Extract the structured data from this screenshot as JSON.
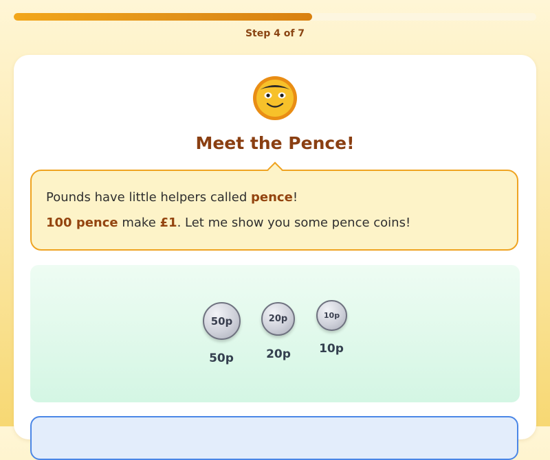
{
  "progress": {
    "step_text": "Step 4 of 7",
    "fraction": 0.571
  },
  "lesson": {
    "title": "Meet the Pence!",
    "bubble": {
      "line1": {
        "pre": "Pounds have little helpers called ",
        "bold": "pence",
        "post": "!"
      },
      "line2": {
        "bold1": "100 pence",
        "mid": " make ",
        "bold2": "£1",
        "post": ". Let me show you some pence coins!"
      }
    },
    "coins": [
      {
        "face": "50p",
        "caption": "50p"
      },
      {
        "face": "20p",
        "caption": "20p"
      },
      {
        "face": "10p",
        "caption": "10p"
      }
    ]
  },
  "colors": {
    "accent": "#efa321",
    "title": "#8a3f12",
    "info_border": "#4a86e6"
  }
}
